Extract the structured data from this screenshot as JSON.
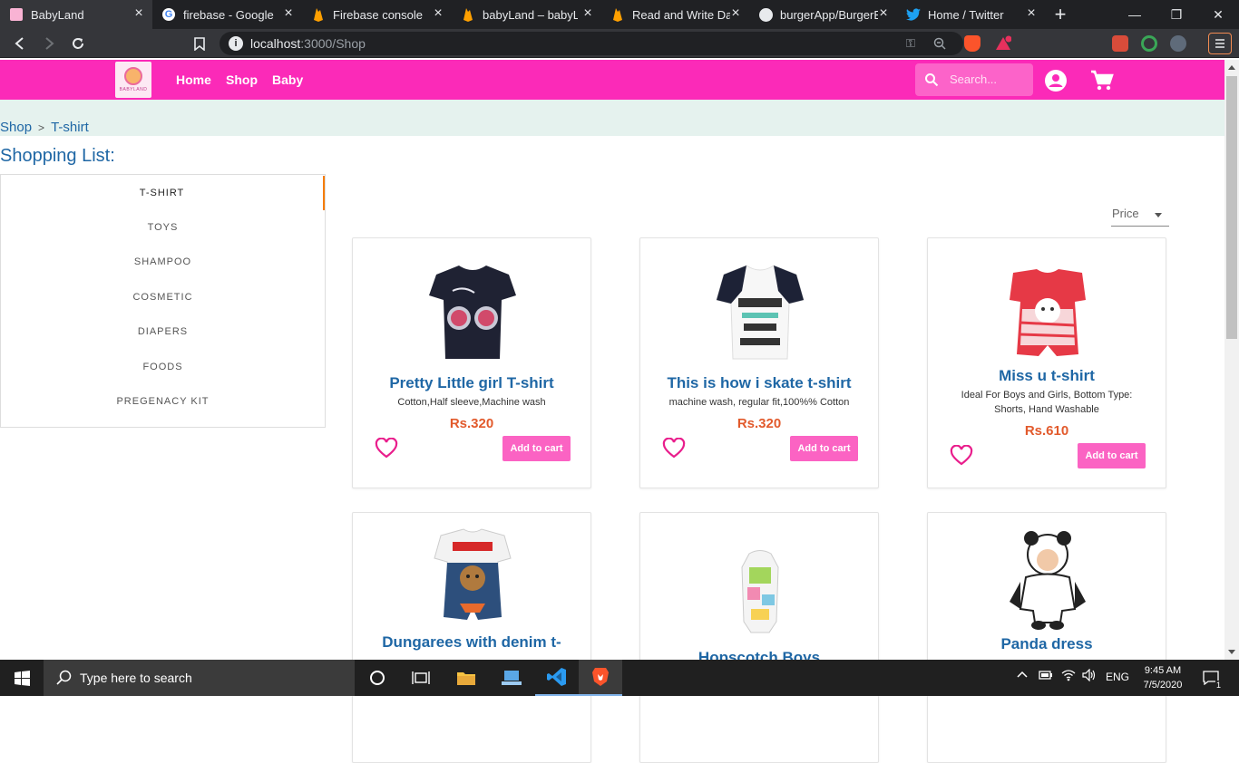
{
  "browser": {
    "tabs": [
      {
        "title": "BabyLand",
        "icon": "babyland-icon"
      },
      {
        "title": "firebase - Google Se",
        "icon": "google-icon"
      },
      {
        "title": "Firebase console",
        "icon": "firebase-icon"
      },
      {
        "title": "babyLand – babyLan",
        "icon": "firebase-icon"
      },
      {
        "title": "Read and Write Data",
        "icon": "firebase-icon"
      },
      {
        "title": "burgerApp/BurgerBu",
        "icon": "github-icon"
      },
      {
        "title": "Home / Twitter",
        "icon": "twitter-icon"
      }
    ],
    "url_host": "localhost",
    "url_path": ":3000/Shop"
  },
  "site": {
    "nav": {
      "home": "Home",
      "shop": "Shop",
      "baby": "Baby"
    },
    "logo_text": "BABYLAND",
    "search_placeholder": "Search..."
  },
  "breadcrumb": {
    "root": "Shop",
    "sep": ">",
    "current": "T-shirt"
  },
  "heading": "Shopping List:",
  "categories": [
    "T-SHIRT",
    "TOYS",
    "SHAMPOO",
    "COSMETIC",
    "DIAPERS",
    "FOODS",
    "PREGENACY KIT"
  ],
  "sort_label": "Price",
  "products": [
    {
      "title": "Pretty Little girl T-shirt",
      "desc": "Cotton,Half sleeve,Machine wash",
      "price": "Rs.320",
      "button": "Add to cart"
    },
    {
      "title": "This is how i skate t-shirt",
      "desc": "machine wash, regular fit,100%% Cotton",
      "price": "Rs.320",
      "button": "Add to cart"
    },
    {
      "title": "Miss u t-shirt",
      "desc": "Ideal For Boys and Girls, Bottom Type: Shorts, Hand Washable",
      "price": "Rs.610",
      "button": "Add to cart"
    },
    {
      "title": "Dungarees with denim t-"
    },
    {
      "title": "Hopscotch Boys"
    },
    {
      "title": "Panda dress"
    }
  ],
  "taskbar": {
    "search_placeholder": "Type here to search",
    "lang": "ENG",
    "time": "9:45 AM",
    "date": "7/5/2020",
    "notifications": "1"
  },
  "colors": {
    "brand_pink": "#fb2ab8",
    "link_blue": "#1f67a5",
    "price_orange": "#e25a2c",
    "button_pink": "#fb63c3"
  }
}
